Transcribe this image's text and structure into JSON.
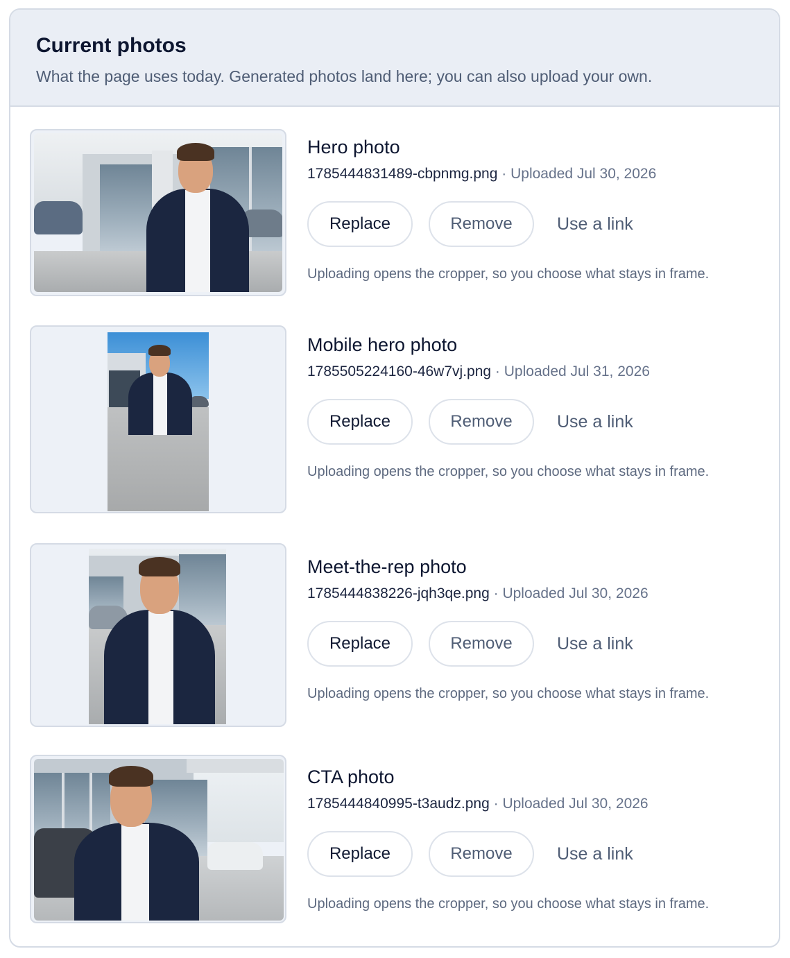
{
  "header": {
    "title": "Current photos",
    "subtitle": "What the page uses today. Generated photos land here; you can also upload your own."
  },
  "photos": [
    {
      "title": "Hero photo",
      "filename": "1785444831489-cbpnmg.png",
      "separator": "·",
      "uploaded": "Uploaded Jul 30, 2026",
      "replace_label": "Replace",
      "remove_label": "Remove",
      "link_label": "Use a link",
      "hint": "Uploading opens the cropper, so you choose what stays in frame."
    },
    {
      "title": "Mobile hero photo",
      "filename": "1785505224160-46w7vj.png",
      "separator": "·",
      "uploaded": "Uploaded Jul 31, 2026",
      "replace_label": "Replace",
      "remove_label": "Remove",
      "link_label": "Use a link",
      "hint": "Uploading opens the cropper, so you choose what stays in frame."
    },
    {
      "title": "Meet-the-rep photo",
      "filename": "1785444838226-jqh3qe.png",
      "separator": "·",
      "uploaded": "Uploaded Jul 30, 2026",
      "replace_label": "Replace",
      "remove_label": "Remove",
      "link_label": "Use a link",
      "hint": "Uploading opens the cropper, so you choose what stays in frame."
    },
    {
      "title": "CTA photo",
      "filename": "1785444840995-t3audz.png",
      "separator": "·",
      "uploaded": "Uploaded Jul 30, 2026",
      "replace_label": "Replace",
      "remove_label": "Remove",
      "link_label": "Use a link",
      "hint": "Uploading opens the cropper, so you choose what stays in frame."
    }
  ],
  "colors": {
    "header_bg": "#eaeef5",
    "border": "#d5dbe5",
    "title_text": "#0d1630",
    "muted_text": "#4f5d75",
    "jacket": "#1b2640"
  }
}
